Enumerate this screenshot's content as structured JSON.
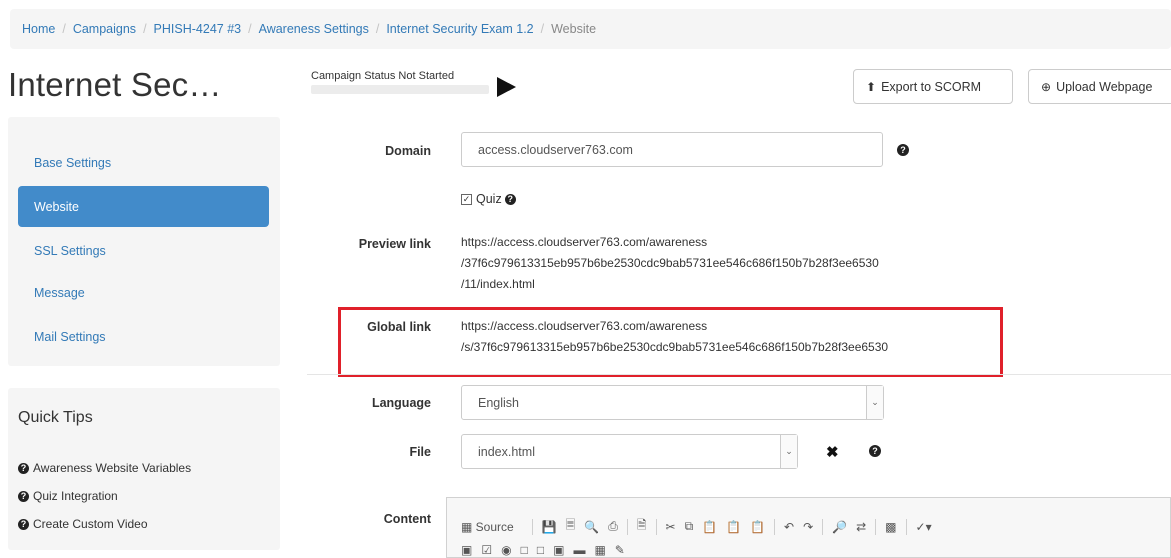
{
  "breadcrumb": [
    {
      "label": "Home",
      "link": true
    },
    {
      "label": "Campaigns",
      "link": true
    },
    {
      "label": "PHISH-4247 #3",
      "link": true
    },
    {
      "label": "Awareness Settings",
      "link": true
    },
    {
      "label": "Internet Security Exam 1.2",
      "link": true
    },
    {
      "label": "Website",
      "link": false
    }
  ],
  "page": {
    "title": "Internet Sec…"
  },
  "status": {
    "text": "Campaign Status Not Started"
  },
  "buttons": {
    "export": "Export to SCORM",
    "upload": "Upload Webpage"
  },
  "sidebar": {
    "items": [
      {
        "label": "Base Settings"
      },
      {
        "label": "Website",
        "active": true
      },
      {
        "label": "SSL Settings"
      },
      {
        "label": "Message"
      },
      {
        "label": "Mail Settings"
      }
    ]
  },
  "tips": {
    "title": "Quick Tips",
    "items": [
      "Awareness Website Variables",
      "Quiz Integration",
      "Create Custom Video"
    ]
  },
  "form": {
    "domain_label": "Domain",
    "domain_value": "access.cloudserver763.com",
    "quiz_label": "Quiz",
    "preview_label": "Preview link",
    "preview_lines": [
      "https://access.cloudserver763.com/awareness",
      "/37f6c979613315eb957b6be2530cdc9bab5731ee546c686f150b7b28f3ee6530",
      "/11/index.html"
    ],
    "global_label": "Global link",
    "global_lines": [
      "https://access.cloudserver763.com/awareness",
      "/s/37f6c979613315eb957b6be2530cdc9bab5731ee546c686f150b7b28f3ee6530"
    ],
    "language_label": "Language",
    "language_value": "English",
    "file_label": "File",
    "file_value": "index.html",
    "content_label": "Content"
  },
  "editor": {
    "source_label": "Source"
  },
  "colors": {
    "accent": "#428bca",
    "link": "#337ab7",
    "highlight": "#e0202a"
  }
}
